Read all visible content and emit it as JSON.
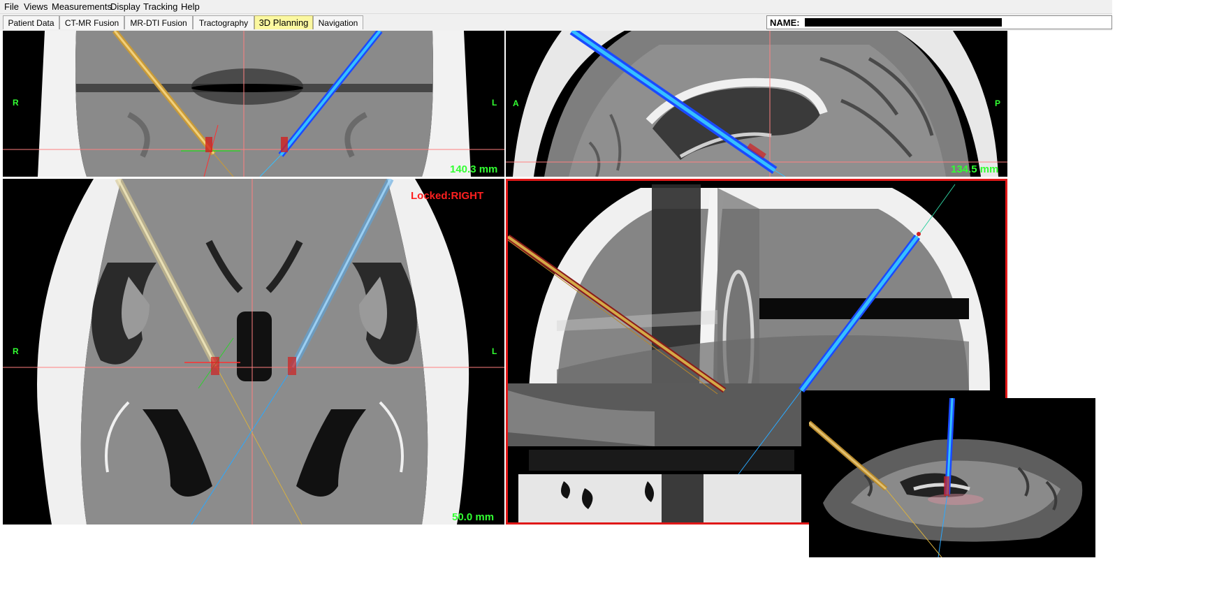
{
  "menu": {
    "file": "File",
    "views": "Views",
    "measurements": "Measurements",
    "display": "Display",
    "tracking": "Tracking",
    "help": "Help"
  },
  "tabs": {
    "patient_data": "Patient Data",
    "ct_mr_fusion": "CT-MR Fusion",
    "mr_dti_fusion": "MR-DTI Fusion",
    "tractography": "Tractography",
    "planning_3d": "3D Planning",
    "navigation": "Navigation"
  },
  "patient": {
    "name_label": "NAME:"
  },
  "views": {
    "coronal": {
      "left": "R",
      "right": "L",
      "distance": "140.3 mm"
    },
    "sagittal": {
      "left": "A",
      "right": "P",
      "distance": "134.5 mm"
    },
    "axial": {
      "left": "R",
      "right": "L",
      "distance": "50.0 mm",
      "lock_status": "Locked:RIGHT"
    }
  },
  "colors": {
    "orientation_label": "#32ff32",
    "lock_label": "#ff2020",
    "active_view_border": "#e01818",
    "active_tab": "#fbf8a0",
    "crosshair": "#ff8080",
    "right_trajectory": "#2aa8ff",
    "left_trajectory": "#d7a640"
  }
}
